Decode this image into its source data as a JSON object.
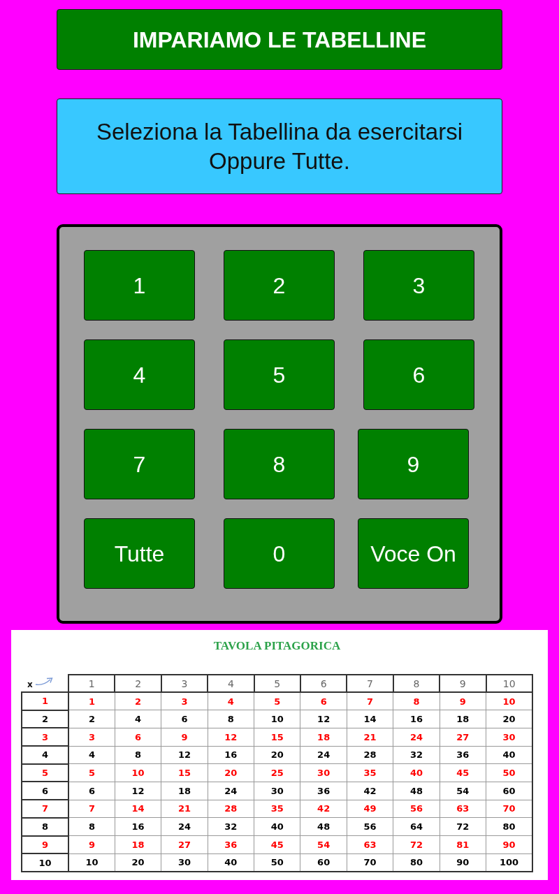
{
  "title": "IMPARIAMO LE TABELLINE",
  "instructions": "Seleziona la Tabellina da esercitarsi Oppure Tutte.",
  "keypad": {
    "rows": [
      [
        "1",
        "2",
        "3"
      ],
      [
        "4",
        "5",
        "6"
      ],
      [
        "7",
        "8",
        "9"
      ],
      [
        "Tutte",
        "0",
        "Voce On"
      ]
    ]
  },
  "table": {
    "title": "TAVOLA PITAGORICA",
    "corner": "x",
    "columns": [
      "1",
      "2",
      "3",
      "4",
      "5",
      "6",
      "7",
      "8",
      "9",
      "10"
    ],
    "rows": [
      {
        "label": "1",
        "color": "#ff0000",
        "cells": [
          "1",
          "2",
          "3",
          "4",
          "5",
          "6",
          "7",
          "8",
          "9",
          "10"
        ]
      },
      {
        "label": "2",
        "color": "#000000",
        "cells": [
          "2",
          "4",
          "6",
          "8",
          "10",
          "12",
          "14",
          "16",
          "18",
          "20"
        ]
      },
      {
        "label": "3",
        "color": "#ff0000",
        "cells": [
          "3",
          "6",
          "9",
          "12",
          "15",
          "18",
          "21",
          "24",
          "27",
          "30"
        ]
      },
      {
        "label": "4",
        "color": "#000000",
        "cells": [
          "4",
          "8",
          "12",
          "16",
          "20",
          "24",
          "28",
          "32",
          "36",
          "40"
        ]
      },
      {
        "label": "5",
        "color": "#ff0000",
        "cells": [
          "5",
          "10",
          "15",
          "20",
          "25",
          "30",
          "35",
          "40",
          "45",
          "50"
        ]
      },
      {
        "label": "6",
        "color": "#000000",
        "cells": [
          "6",
          "12",
          "18",
          "24",
          "30",
          "36",
          "42",
          "48",
          "54",
          "60"
        ]
      },
      {
        "label": "7",
        "color": "#ff0000",
        "cells": [
          "7",
          "14",
          "21",
          "28",
          "35",
          "42",
          "49",
          "56",
          "63",
          "70"
        ]
      },
      {
        "label": "8",
        "color": "#000000",
        "cells": [
          "8",
          "16",
          "24",
          "32",
          "40",
          "48",
          "56",
          "64",
          "72",
          "80"
        ]
      },
      {
        "label": "9",
        "color": "#ff0000",
        "cells": [
          "9",
          "18",
          "27",
          "36",
          "45",
          "54",
          "63",
          "72",
          "81",
          "90"
        ]
      },
      {
        "label": "10",
        "color": "#000000",
        "cells": [
          "10",
          "20",
          "30",
          "40",
          "50",
          "60",
          "70",
          "80",
          "90",
          "100"
        ]
      }
    ]
  }
}
